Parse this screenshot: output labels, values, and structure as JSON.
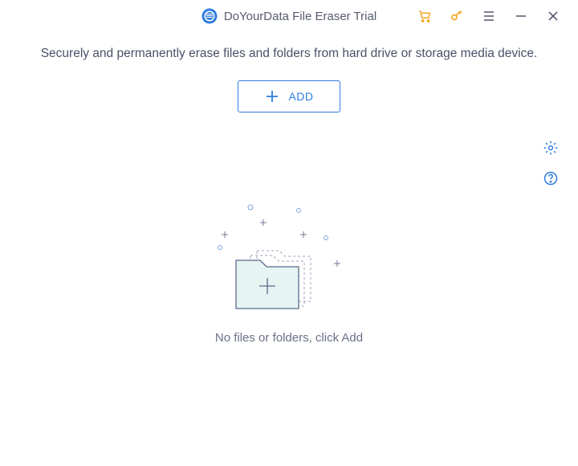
{
  "titlebar": {
    "app_title": "DoYourData File Eraser Trial"
  },
  "header": {
    "description": "Securely and permanently erase files and folders from hard drive or storage media device."
  },
  "actions": {
    "add_label": "ADD"
  },
  "empty_state": {
    "message": "No files or folders, click Add"
  },
  "icons": {
    "logo": "app-logo",
    "cart": "cart-icon",
    "key": "key-icon",
    "menu": "menu-icon",
    "minimize": "minimize-icon",
    "close": "close-icon",
    "settings": "gear-icon",
    "help": "help-icon"
  },
  "colors": {
    "accent": "#2f7de1",
    "orange": "#f5a623",
    "text": "#4a5168",
    "muted": "#6b7189"
  }
}
